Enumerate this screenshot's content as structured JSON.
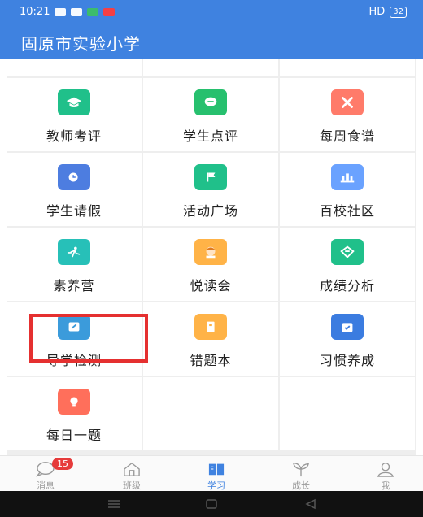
{
  "status_bar": {
    "time": "10:21",
    "net": "HD",
    "battery": "32"
  },
  "app": {
    "title": "固原市实验小学"
  },
  "grid": {
    "items": [
      {
        "label": "教师考评",
        "icon": "graduation-cap-icon",
        "color": "#20c08a"
      },
      {
        "label": "学生点评",
        "icon": "comment-icon",
        "color": "#27c06e"
      },
      {
        "label": "每周食谱",
        "icon": "utensils-icon",
        "color": "#ff7b6a"
      },
      {
        "label": "学生请假",
        "icon": "clock-icon",
        "color": "#4d7de0"
      },
      {
        "label": "活动广场",
        "icon": "flag-icon",
        "color": "#20c08a"
      },
      {
        "label": "百校社区",
        "icon": "buildings-icon",
        "color": "#6aa2ff"
      },
      {
        "label": "素养营",
        "icon": "runner-icon",
        "color": "#27c0b8"
      },
      {
        "label": "悦读会",
        "icon": "reader-avatar-icon",
        "color": "#ffb347"
      },
      {
        "label": "成绩分析",
        "icon": "analysis-icon",
        "color": "#20c08a"
      },
      {
        "label": "导学检测",
        "icon": "edit-icon",
        "color": "#3b9bdb"
      },
      {
        "label": "错题本",
        "icon": "notebook-icon",
        "color": "#ffb347"
      },
      {
        "label": "习惯养成",
        "icon": "calendar-check-icon",
        "color": "#3b7ce0"
      },
      {
        "label": "每日一题",
        "icon": "lightbulb-icon",
        "color": "#ff6f5b"
      }
    ]
  },
  "tabs": [
    {
      "label": "消息",
      "icon": "chat-icon",
      "badge": "15"
    },
    {
      "label": "班级",
      "icon": "home-icon"
    },
    {
      "label": "学习",
      "icon": "book-icon",
      "active": true
    },
    {
      "label": "成长",
      "icon": "sprout-icon"
    },
    {
      "label": "我",
      "icon": "user-icon"
    }
  ],
  "colors": {
    "primary": "#3f82e0",
    "highlight": "#e53030"
  }
}
